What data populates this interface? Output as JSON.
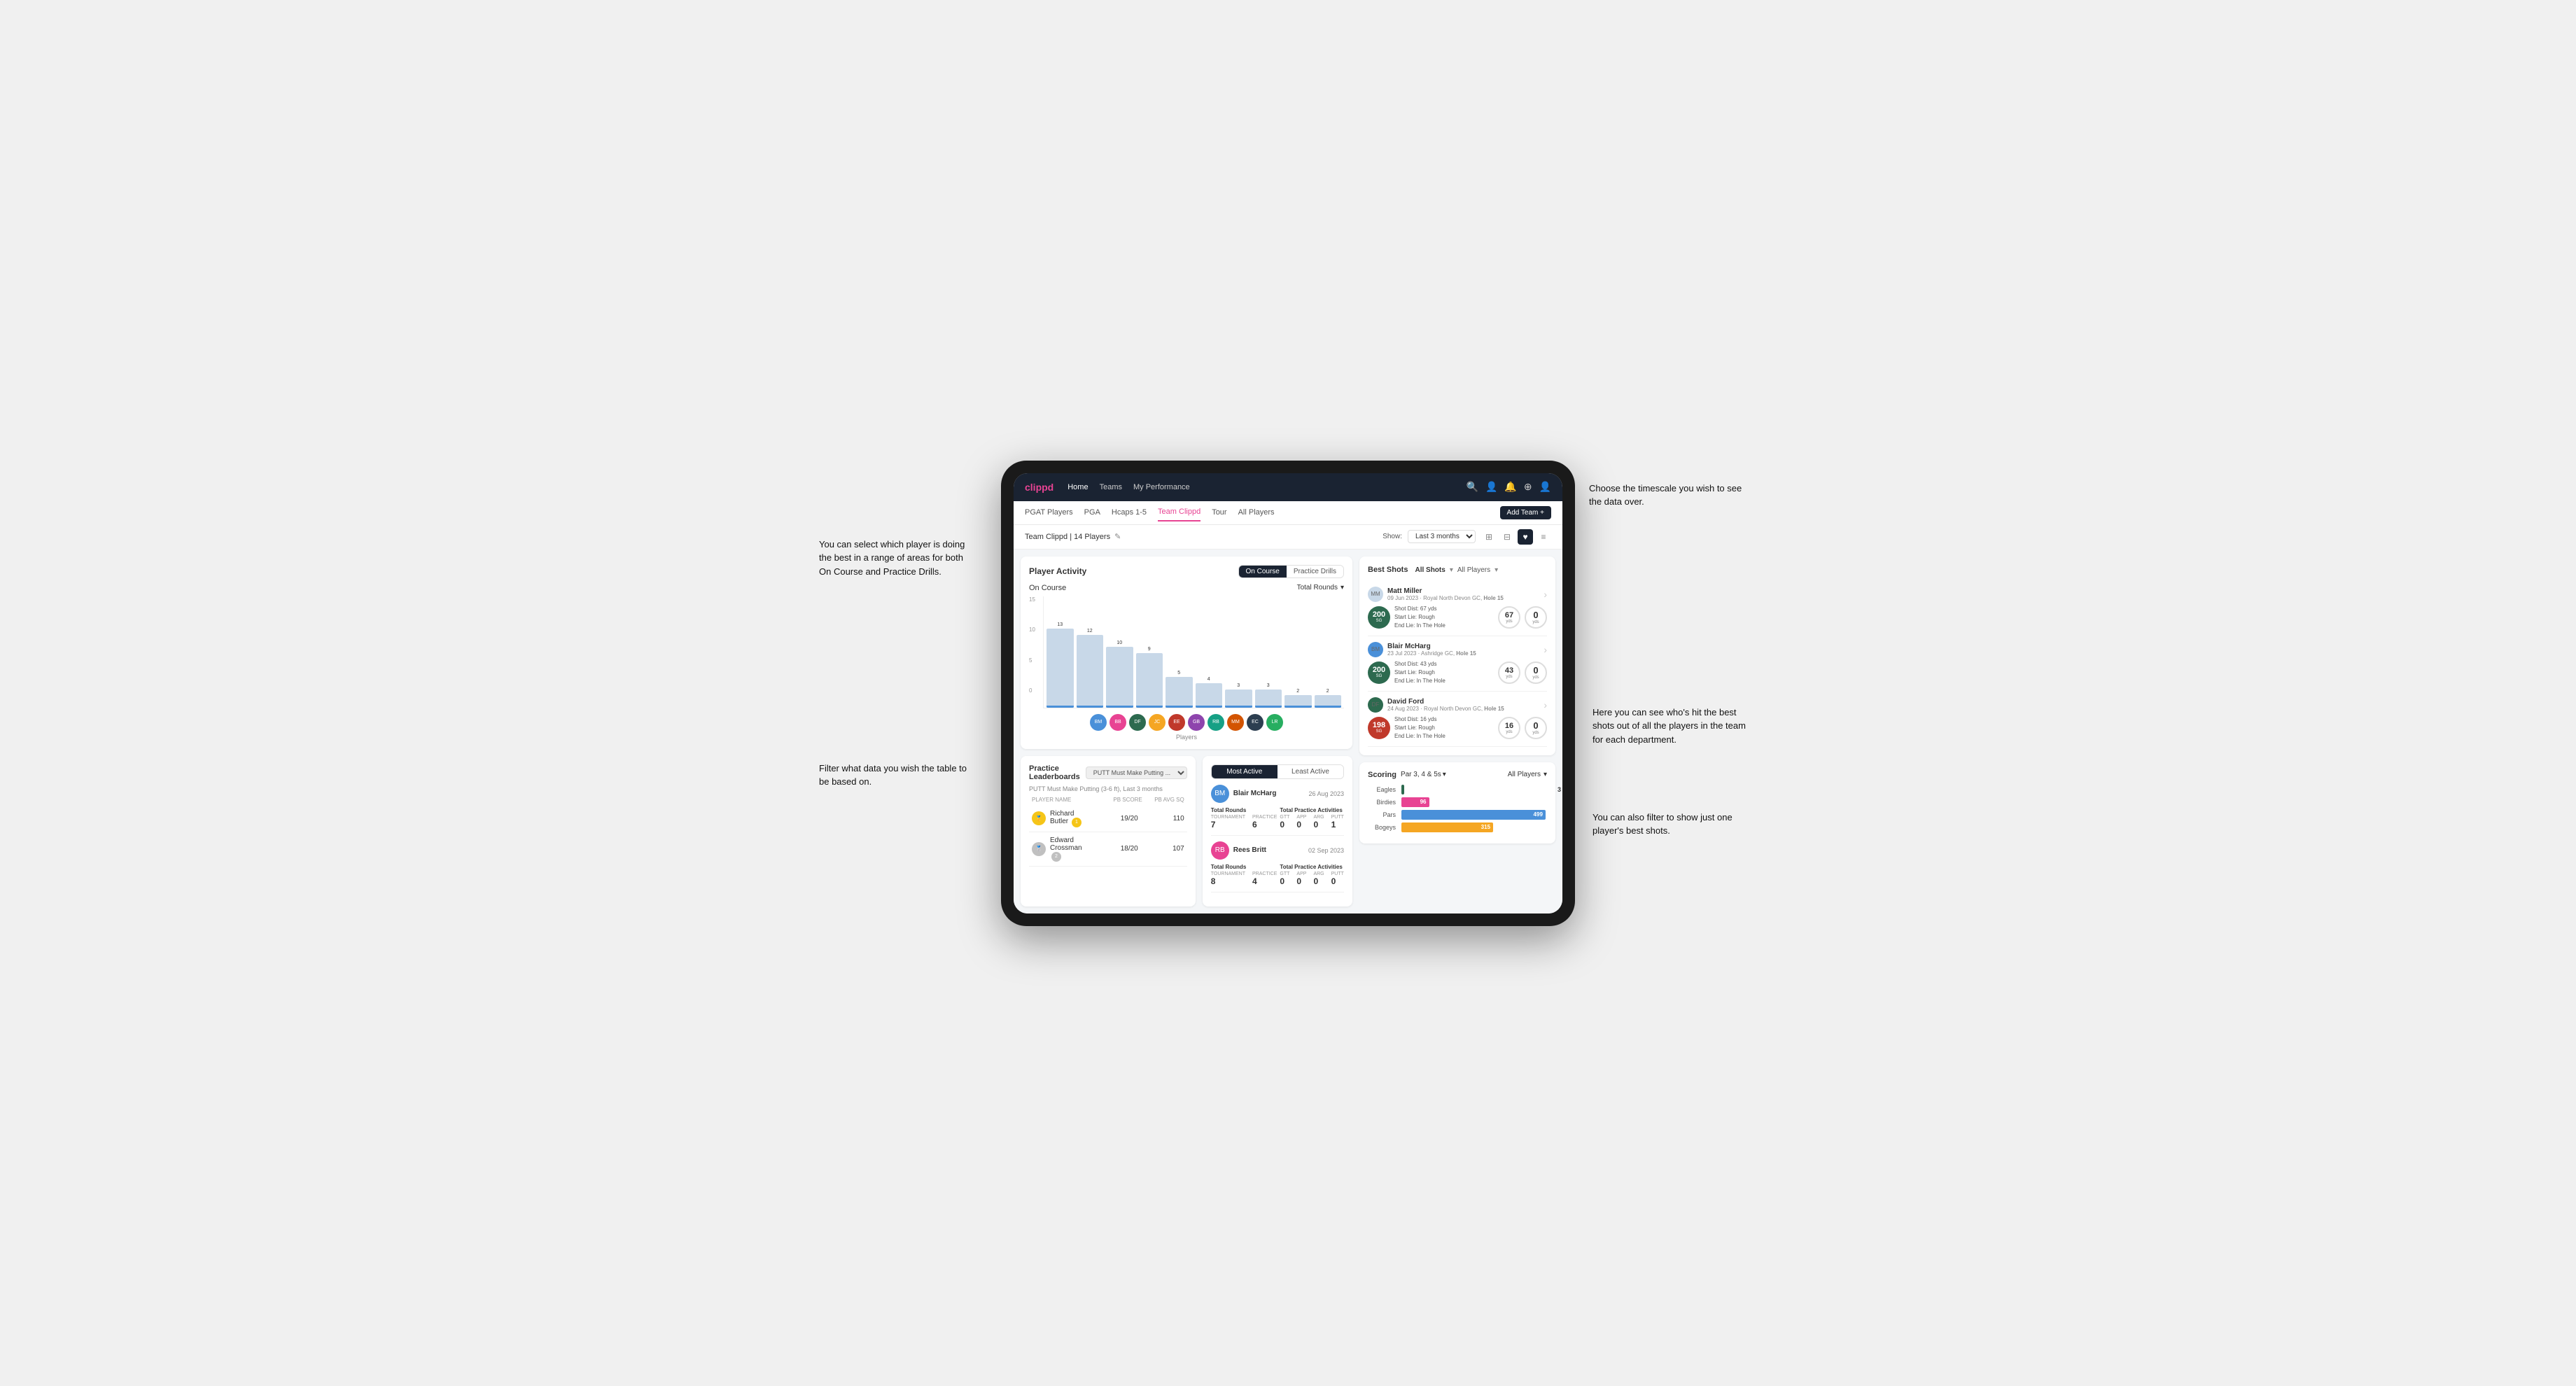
{
  "annotations": {
    "top_right": "Choose the timescale you wish to see the data over.",
    "left_top": "You can select which player is doing the best in a range of areas for both On Course and Practice Drills.",
    "left_bottom": "Filter what data you wish the table to be based on.",
    "right_mid": "Here you can see who's hit the best shots out of all the players in the team for each department.",
    "right_bottom": "You can also filter to show just one player's best shots."
  },
  "nav": {
    "logo": "clippd",
    "links": [
      "Home",
      "Teams",
      "My Performance"
    ],
    "icons": [
      "🔍",
      "👤",
      "🔔",
      "⊕",
      "👤"
    ]
  },
  "sub_nav": {
    "links": [
      "PGAT Players",
      "PGA",
      "Hcaps 1-5",
      "Team Clippd",
      "Tour",
      "All Players"
    ],
    "active": "Team Clippd",
    "add_button": "Add Team +"
  },
  "team_header": {
    "name": "Team Clippd | 14 Players",
    "show_label": "Show:",
    "show_value": "Last 3 months",
    "view_modes": [
      "⊞",
      "⊟",
      "♥",
      "≡"
    ]
  },
  "player_activity": {
    "title": "Player Activity",
    "toggle": [
      "On Course",
      "Practice Drills"
    ],
    "active_toggle": "On Course",
    "section_label": "On Course",
    "chart_dropdown": "Total Rounds",
    "y_axis": [
      "15",
      "10",
      "5",
      "0"
    ],
    "bars": [
      {
        "label": "B. McHarg",
        "value": 13
      },
      {
        "label": "B. Britt",
        "value": 12
      },
      {
        "label": "D. Ford",
        "value": 10
      },
      {
        "label": "J. Coles",
        "value": 9
      },
      {
        "label": "E. Ebert",
        "value": 5
      },
      {
        "label": "G. Billingham",
        "value": 4
      },
      {
        "label": "R. Butler",
        "value": 3
      },
      {
        "label": "M. Miller",
        "value": 3
      },
      {
        "label": "E. Crossman",
        "value": 2
      },
      {
        "label": "L. Robertson",
        "value": 2
      }
    ],
    "x_label": "Players"
  },
  "best_shots": {
    "title": "Best Shots",
    "tabs": [
      "All Shots",
      "Players"
    ],
    "filter": "All Players",
    "shots": [
      {
        "player": "Matt Miller",
        "date": "09 Jun 2023",
        "course": "Royal North Devon GC",
        "hole": "Hole 15",
        "badge_num": "200",
        "badge_sub": "SG",
        "details": "Shot Dist: 67 yds\nStart Lie: Rough\nEnd Lie: In The Hole",
        "dist_val": "67",
        "dist_unit": "yds",
        "end_val": "0",
        "end_unit": "yds"
      },
      {
        "player": "Blair McHarg",
        "date": "23 Jul 2023",
        "course": "Ashridge GC",
        "hole": "Hole 15",
        "badge_num": "200",
        "badge_sub": "SG",
        "details": "Shot Dist: 43 yds\nStart Lie: Rough\nEnd Lie: In The Hole",
        "dist_val": "43",
        "dist_unit": "yds",
        "end_val": "0",
        "end_unit": "yds"
      },
      {
        "player": "David Ford",
        "date": "24 Aug 2023",
        "course": "Royal North Devon GC",
        "hole": "Hole 15",
        "badge_num": "198",
        "badge_sub": "SG",
        "details": "Shot Dist: 16 yds\nStart Lie: Rough\nEnd Lie: In The Hole",
        "dist_val": "16",
        "dist_unit": "yds",
        "end_val": "0",
        "end_unit": "yds"
      }
    ]
  },
  "leaderboards": {
    "title": "Practice Leaderboards",
    "dropdown": "PUTT Must Make Putting ...",
    "subtitle": "PUTT Must Make Putting (3-6 ft), Last 3 months",
    "columns": [
      "PLAYER NAME",
      "PB SCORE",
      "PB AVG SQ"
    ],
    "rows": [
      {
        "rank": "1",
        "name": "Richard Butler",
        "badge": "1",
        "score": "19/20",
        "avg": "110"
      },
      {
        "rank": "2",
        "name": "Edward Crossman",
        "badge": "2",
        "score": "18/20",
        "avg": "107"
      }
    ]
  },
  "most_active": {
    "tabs": [
      "Most Active",
      "Least Active"
    ],
    "active_tab": "Most Active",
    "players": [
      {
        "name": "Blair McHarg",
        "date": "26 Aug 2023",
        "rounds": {
          "tournament": "7",
          "practice": "6"
        },
        "practice_activities": {
          "gtt": "0",
          "app": "0",
          "arg": "0",
          "putt": "1"
        }
      },
      {
        "name": "Rees Britt",
        "date": "02 Sep 2023",
        "rounds": {
          "tournament": "8",
          "practice": "4"
        },
        "practice_activities": {
          "gtt": "0",
          "app": "0",
          "arg": "0",
          "putt": "0"
        }
      }
    ]
  },
  "scoring": {
    "title": "Scoring",
    "dropdown": "Par 3, 4 & 5s",
    "filter": "All Players",
    "rows": [
      {
        "label": "Eagles",
        "value": 3,
        "max": 500,
        "color": "eagles"
      },
      {
        "label": "Birdies",
        "value": 96,
        "max": 500,
        "color": "birdies"
      },
      {
        "label": "Pars",
        "value": 499,
        "max": 500,
        "color": "pars"
      },
      {
        "label": "Bogeys",
        "value": 315,
        "max": 500,
        "color": "bogeys"
      }
    ]
  }
}
